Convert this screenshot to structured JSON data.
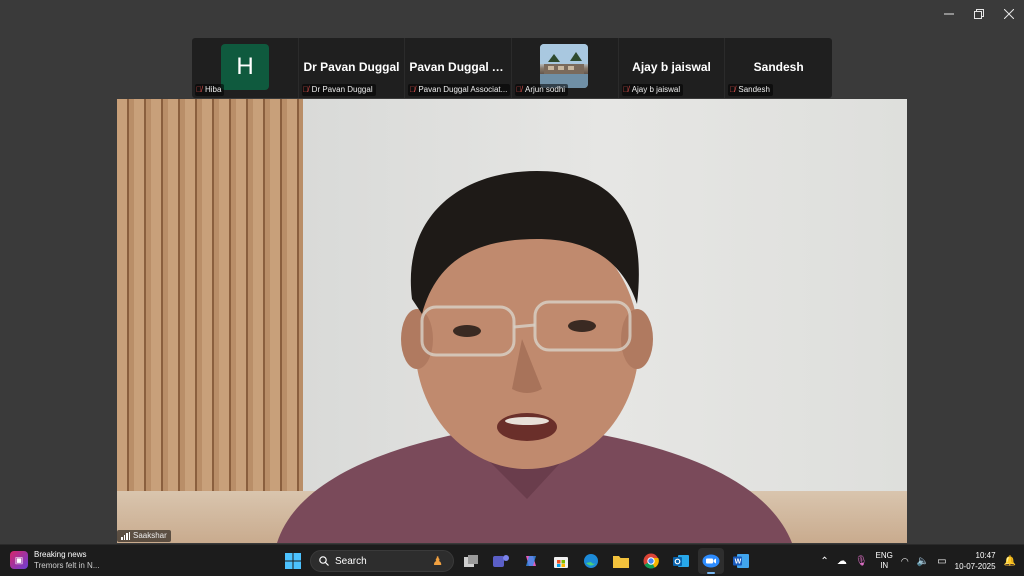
{
  "window": {
    "controls": [
      "minimize",
      "restore",
      "close"
    ]
  },
  "participants": [
    {
      "display": "H",
      "type": "avatar",
      "name": "Hiba",
      "avatar_color": "#0f5a3e"
    },
    {
      "display": "Dr Pavan Duggal",
      "type": "name",
      "name": "Dr Pavan Duggal"
    },
    {
      "display": "Pavan Duggal A...",
      "type": "name",
      "name": "Pavan Duggal Associat..."
    },
    {
      "display": "",
      "type": "photo",
      "name": "Arjun sodhi"
    },
    {
      "display": "Ajay b jaiswal",
      "type": "name",
      "name": "Ajay b jaiswal"
    },
    {
      "display": "Sandesh",
      "type": "name",
      "name": "Sandesh"
    }
  ],
  "main_video": {
    "speaker_name": "Saakshar"
  },
  "taskbar": {
    "news_title": "Breaking news",
    "news_sub": "Tremors felt in N...",
    "search_placeholder": "Search",
    "language_top": "ENG",
    "language_bottom": "IN",
    "time": "10:47",
    "date": "10-07-2025",
    "accent": "#79b8f3"
  }
}
